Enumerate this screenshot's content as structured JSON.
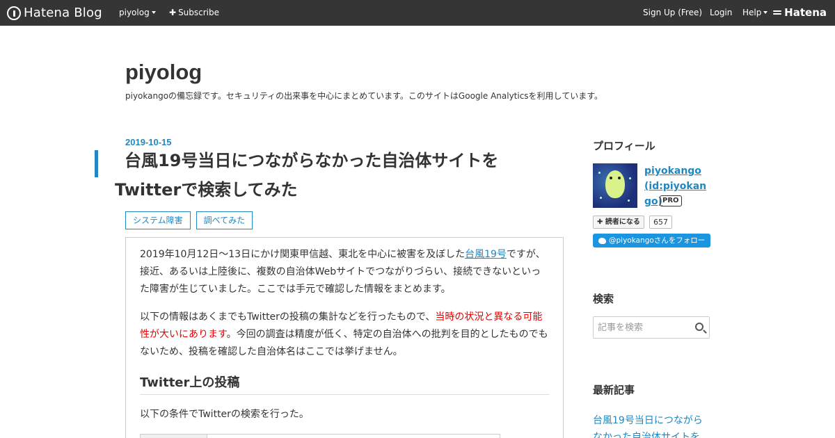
{
  "topbar": {
    "brand": "Hatena Blog",
    "blog_menu": "piyolog",
    "subscribe": "Subscribe",
    "signup": "Sign Up (Free)",
    "login": "Login",
    "help": "Help",
    "hatena": "Hatena"
  },
  "blog": {
    "title": "piyolog",
    "description": "piyokangoの備忘録です。セキュリティの出来事を中心にまとめています。このサイトはGoogle Analyticsを利用しています。"
  },
  "entry": {
    "date": "2019-10-15",
    "title": "台風19号当日につながらなかった自治体サイトをTwitterで検索してみた",
    "categories": [
      "システム障害",
      "調べてみた"
    ],
    "p1_before": "2019年10月12日～13日にかけ関東甲信越、東北を中心に被害を及ぼした",
    "p1_link": "台風19号",
    "p1_after": "ですが、接近、あるいは上陸後に、複数の自治体Webサイトでつながりづらい、接続できないといった障害が生じていました。ここでは手元で確認した情報をまとめます。",
    "p2_before": "以下の情報はあくまでもTwitterの投稿の集計などを行ったもので、",
    "p2_red": "当時の状況と異なる可能性が大いにあります",
    "p2_after": "。今回の調査は精度が低く、特定の自治体への批判を目的としたものでもないため、投稿を確認した自治体名はここでは挙げません。",
    "h3": "Twitter上の投稿",
    "p3": "以下の条件でTwitterの検索を行った。"
  },
  "sidebar": {
    "profile_heading": "プロフィール",
    "profile_name": "piyokango (id:piyokango)",
    "pro_badge": "PRO",
    "reader_button": "読者になる",
    "reader_count": "657",
    "twitter_follow": "@piyokangoさんをフォロー",
    "search_heading": "検索",
    "search_placeholder": "記事を検索",
    "recent_heading": "最新記事",
    "recent_first": "台風19号当日につながらなかった自治体サイトを"
  },
  "colors": {
    "accent": "#2187c0",
    "topbar": "#353535",
    "warning_text": "#e60000",
    "twitter": "#1b95e0"
  }
}
